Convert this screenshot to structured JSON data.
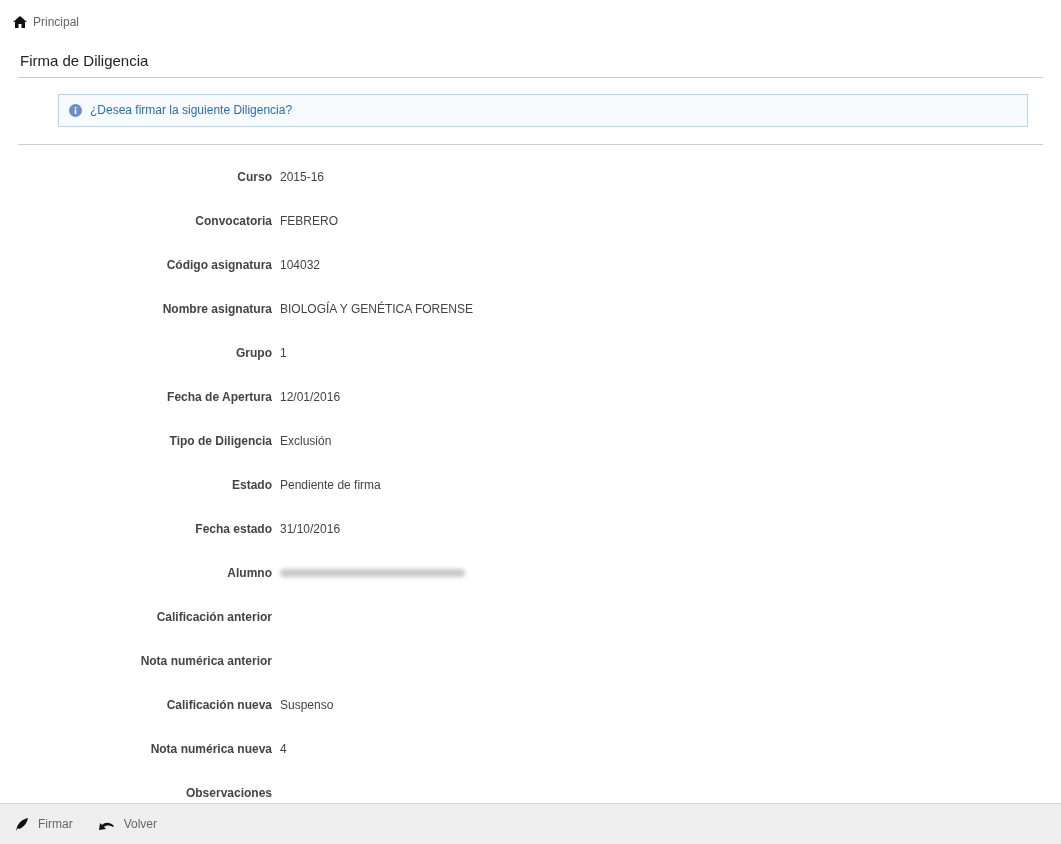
{
  "breadcrumb": {
    "label": "Principal"
  },
  "title": "Firma de Diligencia",
  "info_message": "¿Desea firmar la siguiente Diligencia?",
  "fields": [
    {
      "label": "Curso",
      "value": "2015-16"
    },
    {
      "label": "Convocatoria",
      "value": "FEBRERO"
    },
    {
      "label": "Código asignatura",
      "value": "104032"
    },
    {
      "label": "Nombre asignatura",
      "value": "BIOLOGÍA Y GENÉTICA FORENSE"
    },
    {
      "label": "Grupo",
      "value": "1"
    },
    {
      "label": "Fecha de Apertura",
      "value": "12/01/2016"
    },
    {
      "label": "Tipo de Diligencia",
      "value": "Exclusión"
    },
    {
      "label": "Estado",
      "value": "Pendiente de firma"
    },
    {
      "label": "Fecha estado",
      "value": "31/10/2016"
    },
    {
      "label": "Alumno",
      "value_hidden": true
    },
    {
      "label": "Calificación anterior"
    },
    {
      "label": "Nota numérica anterior"
    },
    {
      "label": "Calificación nueva",
      "value": "Suspenso"
    },
    {
      "label": "Nota numérica nueva",
      "value": "4"
    },
    {
      "label": "Observaciones"
    }
  ],
  "actions": [
    {
      "kind": "sign",
      "label": "Firmar"
    },
    {
      "kind": "back",
      "label": "Volver"
    }
  ]
}
